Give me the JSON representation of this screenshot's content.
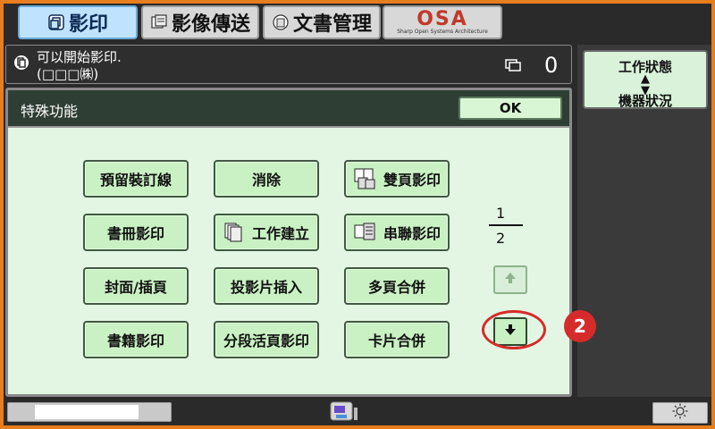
{
  "tabs": [
    {
      "label": "影印",
      "icon": "copy-icon"
    },
    {
      "label": "影像傳送",
      "icon": "image-send-icon"
    },
    {
      "label": "文書管理",
      "icon": "document-filing-icon"
    },
    {
      "logo_text": "OSA",
      "logo_sub": "Sharp Open Systems Architecture"
    }
  ],
  "status": {
    "line1": "可以開始影印.",
    "line2": "(□□□㈱)",
    "count": "0"
  },
  "right_panel": {
    "job_status_label": "工作狀態",
    "machine_status_label": "機器狀況"
  },
  "panel": {
    "title": "特殊功能",
    "ok_label": "OK",
    "buttons": [
      {
        "label": "預留裝訂線"
      },
      {
        "label": "消除"
      },
      {
        "label": "雙頁影印",
        "icon": "dual-page-icon"
      },
      {
        "label": "書冊影印"
      },
      {
        "label": "工作建立",
        "icon": "job-build-icon"
      },
      {
        "label": "串聯影印",
        "icon": "tandem-copy-icon"
      },
      {
        "label": "封面/插頁"
      },
      {
        "label": "投影片插入"
      },
      {
        "label": "多頁合併"
      },
      {
        "label": "書籍影印"
      },
      {
        "label": "分段活頁影印"
      },
      {
        "label": "卡片合併"
      }
    ],
    "page_current": "1",
    "page_total": "2",
    "callout_number": "2"
  },
  "colors": {
    "frame": "#e77d1c",
    "panel_bg": "#e3f6e3",
    "button_bg": "#c9f1c3",
    "callout": "#d62b2b"
  }
}
